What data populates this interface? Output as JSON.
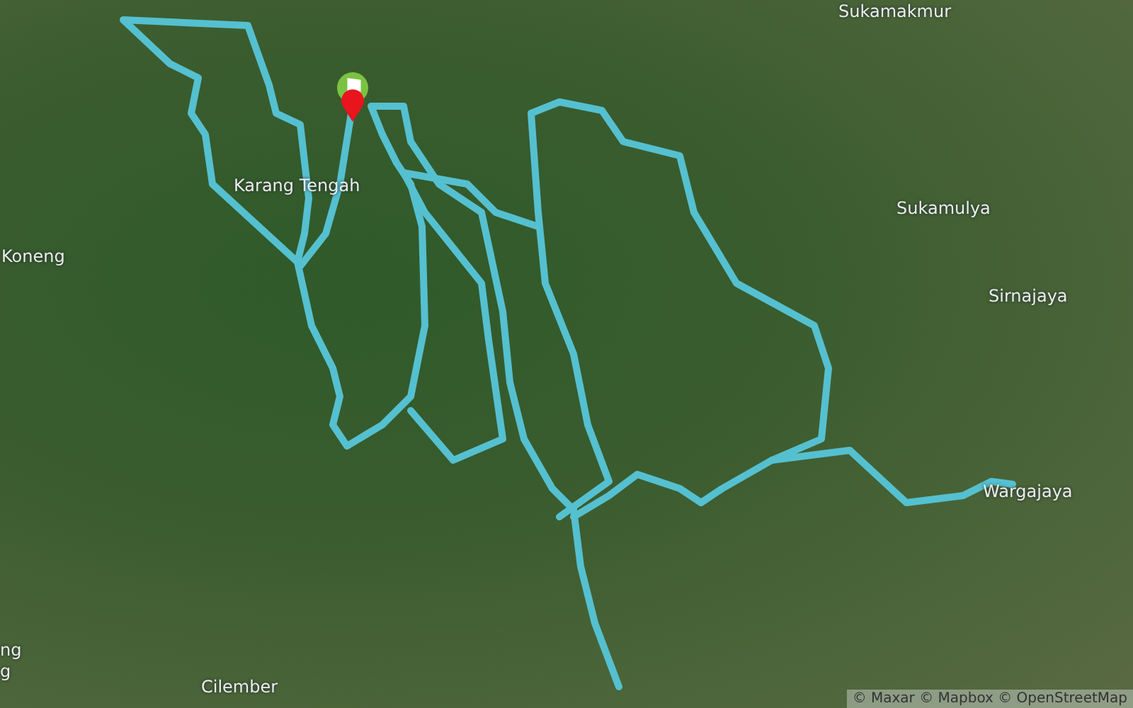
{
  "map": {
    "place_labels": [
      {
        "text": "Sukamakmur"
      },
      {
        "text": "Karang Tengah"
      },
      {
        "text": "Koneng"
      },
      {
        "text": "Sukamulya"
      },
      {
        "text": "Sirnajaya"
      },
      {
        "text": "Wargajaya"
      },
      {
        "text": "Cilember"
      },
      {
        "text": "ng"
      },
      {
        "text": "g"
      }
    ],
    "attribution": "© Maxar © Mapbox © OpenStreetMap"
  }
}
